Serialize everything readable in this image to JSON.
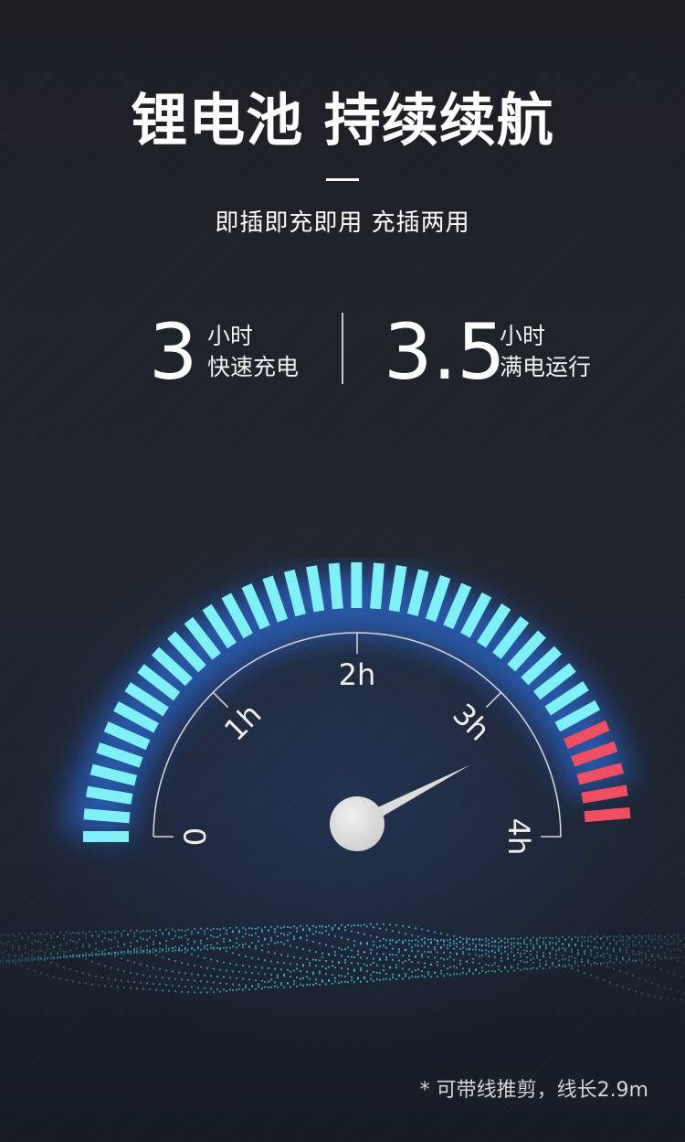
{
  "title": "锂电池 持续续航",
  "subtitle": "即插即充即用 充插两用",
  "stats": [
    {
      "number": "3",
      "unit": "小时",
      "desc": "快速充电"
    },
    {
      "number": "3.5",
      "unit": "小时",
      "desc": "满电运行"
    }
  ],
  "gauge": {
    "labels": [
      "0",
      "1h",
      "2h",
      "3h",
      "4h"
    ],
    "segments_total": 38,
    "segments_red": 5,
    "needle_value_hours": 3.5,
    "colors": {
      "bar": "#7ff0f6",
      "glow": "#2f7cff",
      "warn": "#ef4f62",
      "needle": "#dcdcdc"
    }
  },
  "footnote": "* 可带线推剪，线长2.9m"
}
